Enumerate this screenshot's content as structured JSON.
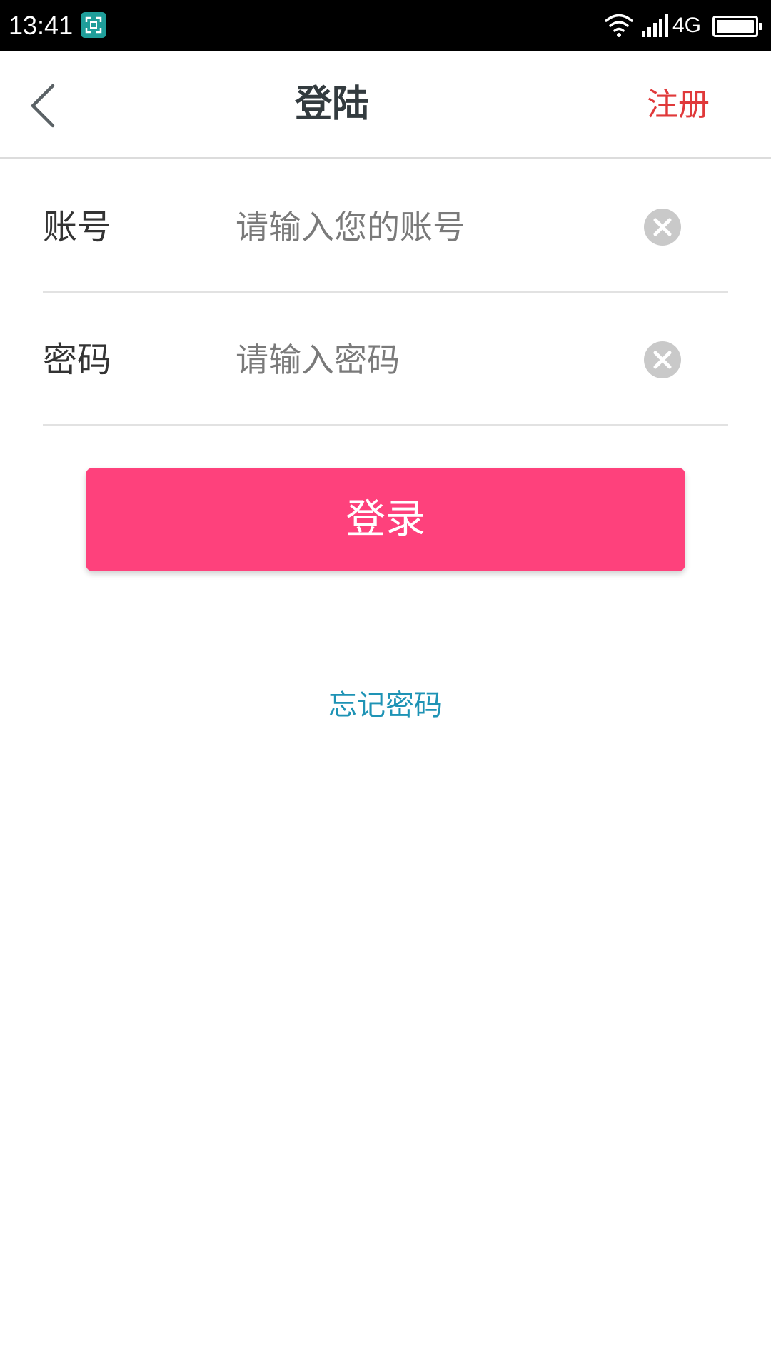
{
  "status_bar": {
    "time": "13:41",
    "network": "4G",
    "battery_level": 1.0,
    "icons": [
      "screenshot-app-icon",
      "wifi-icon",
      "signal-icon",
      "battery-icon"
    ]
  },
  "nav": {
    "title": "登陆",
    "register_label": "注册",
    "back_icon": "chevron-left-icon"
  },
  "form": {
    "account": {
      "label": "账号",
      "value": "",
      "placeholder": "请输入您的账号",
      "clear_icon": "clear-circle-icon"
    },
    "password": {
      "label": "密码",
      "value": "",
      "placeholder": "请输入密码",
      "clear_icon": "clear-circle-icon"
    }
  },
  "login_label": "登录",
  "forgot_label": "忘记密码",
  "colors": {
    "primary": "#fe417c",
    "register": "#e0393a",
    "link": "#1e93b5",
    "title": "#333b3f"
  }
}
